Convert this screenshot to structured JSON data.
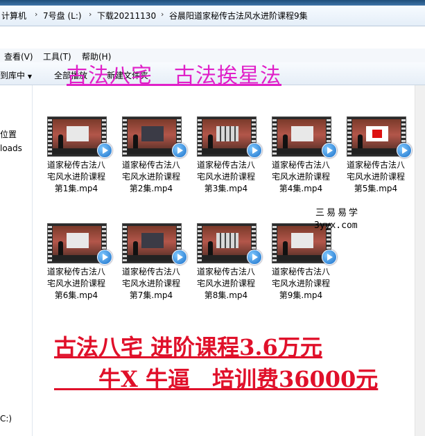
{
  "address": {
    "crumbs": [
      "计算机",
      "7号盘 (L:)",
      "下载20211130",
      "谷晨阳道家秘传古法风水进阶课程9集"
    ]
  },
  "menu": {
    "view": "查看(V)",
    "tools": "工具(T)",
    "help": "帮助(H)"
  },
  "toolbar": {
    "include_in_library": "到库中",
    "share": "全部播放",
    "new_folder": "新建文件夹"
  },
  "nav": {
    "item_location": "位置",
    "item_downloads": "loads",
    "item_drive": "C:)"
  },
  "files": [
    {
      "line1": "道家秘传古法八",
      "line2": "宅风水进阶课程",
      "line3": "第1集.mp4",
      "screen": "light"
    },
    {
      "line1": "道家秘传古法八",
      "line2": "宅风水进阶课程",
      "line3": "第2集.mp4",
      "screen": "dark"
    },
    {
      "line1": "道家秘传古法八",
      "line2": "宅风水进阶课程",
      "line3": "第3集.mp4",
      "screen": "grid"
    },
    {
      "line1": "道家秘传古法八",
      "line2": "宅风水进阶课程",
      "line3": "第4集.mp4",
      "screen": "light"
    },
    {
      "line1": "道家秘传古法八",
      "line2": "宅风水进阶课程",
      "line3": "第5集.mp4",
      "screen": "red"
    },
    {
      "line1": "道家秘传古法八",
      "line2": "宅风水进阶课程",
      "line3": "第6集.mp4",
      "screen": "light"
    },
    {
      "line1": "道家秘传古法八",
      "line2": "宅风水进阶课程",
      "line3": "第7集.mp4",
      "screen": "dark"
    },
    {
      "line1": "道家秘传古法八",
      "line2": "宅风水进阶课程",
      "line3": "第8集.mp4",
      "screen": "grid"
    },
    {
      "line1": "道家秘传古法八",
      "line2": "宅风水进阶课程",
      "line3": "第9集.mp4",
      "screen": "light"
    }
  ],
  "watermark": {
    "cn": "三易易学",
    "url": "3yyx.com"
  },
  "overlay": {
    "top": "古法八宅　古法挨星法",
    "line1": "古法八宅 进阶课程3.6万元",
    "line2": "　　牛X  牛逼　培训费36000元"
  },
  "colors": {
    "magenta": "#e020c8",
    "red": "#e0102a"
  }
}
